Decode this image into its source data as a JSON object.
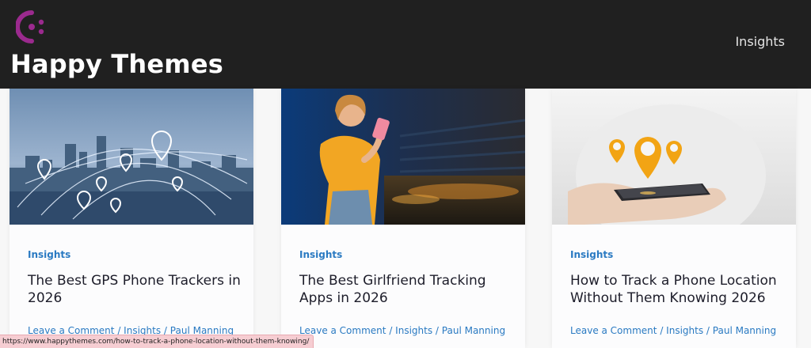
{
  "site": {
    "title": "Happy Themes",
    "logo_color": "#9b2a8e"
  },
  "nav": {
    "items": [
      {
        "label": "Insights"
      }
    ]
  },
  "posts": [
    {
      "category": "Insights",
      "title": "The Best GPS Phone Trackers in 2026",
      "meta": {
        "comment": "Leave a Comment",
        "category": "Insights",
        "author": "Paul Manning"
      },
      "image": "city-skyline-gps-pins"
    },
    {
      "category": "Insights",
      "title": "The Best Girlfriend Tracking Apps in 2026",
      "meta": {
        "comment": "Leave a Comment",
        "category": "Insights",
        "author": "Paul Manning"
      },
      "image": "woman-smiling-at-phone"
    },
    {
      "category": "Insights",
      "title": "How to Track a Phone Location Without Them Knowing 2026",
      "meta": {
        "comment": "Leave a Comment",
        "category": "Insights",
        "author": "Paul Manning"
      },
      "image": "hand-holding-phone-location-pins"
    }
  ],
  "status_bar": {
    "url": "https://www.happythemes.com/how-to-track-a-phone-location-without-them-knowing/"
  },
  "colors": {
    "header_bg": "#202020",
    "link": "#2a7ac2",
    "title_text": "#1d1d2a"
  }
}
